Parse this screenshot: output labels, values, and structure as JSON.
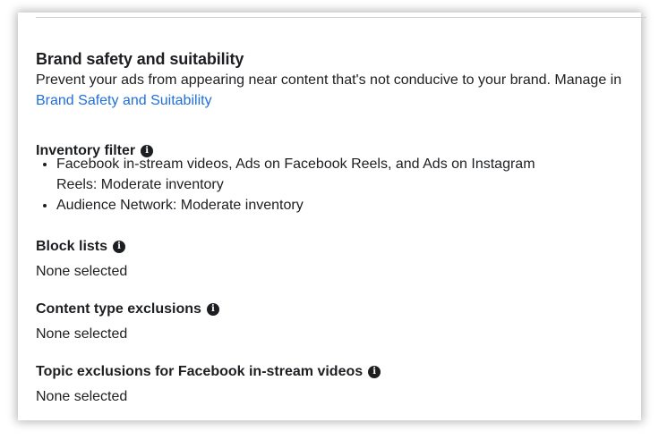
{
  "brand_safety": {
    "title": "Brand safety and suitability",
    "description": "Prevent your ads from appearing near content that's not conducive to your brand. Manage in ",
    "link_text": "Brand Safety and Suitability"
  },
  "inventory_filter": {
    "label": "Inventory filter",
    "icon": "info-icon",
    "items": [
      "Facebook in-stream videos, Ads on Facebook Reels, and Ads on Instagram Reels: Moderate inventory",
      "Audience Network: Moderate inventory"
    ]
  },
  "block_lists": {
    "label": "Block lists",
    "icon": "info-icon",
    "value": "None selected"
  },
  "content_type_exclusions": {
    "label": "Content type exclusions",
    "icon": "info-icon",
    "value": "None selected"
  },
  "topic_exclusions": {
    "label": "Topic exclusions for Facebook in-stream videos",
    "icon": "info-icon",
    "value": "None selected"
  },
  "colors": {
    "link": "#216fdb",
    "text": "#1c1e21"
  }
}
